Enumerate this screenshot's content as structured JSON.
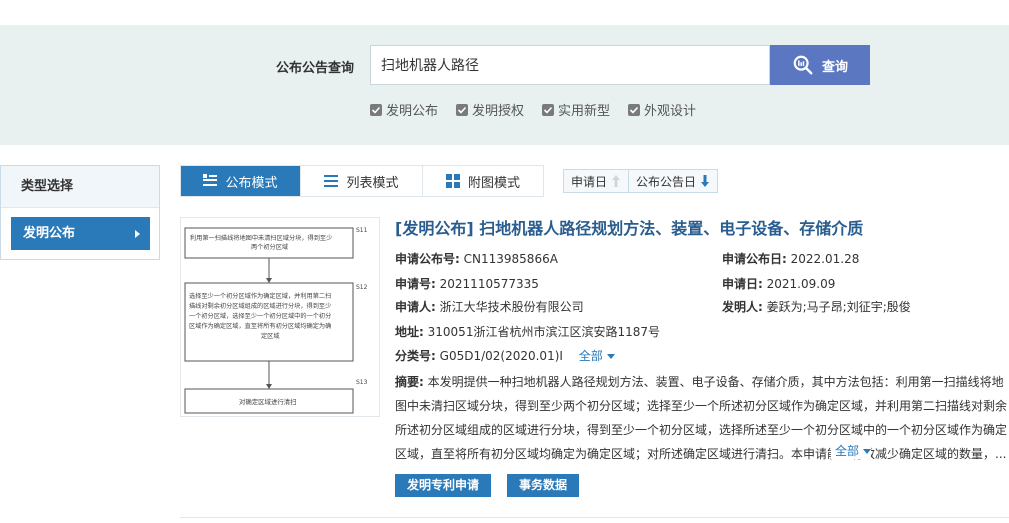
{
  "search": {
    "label": "公布公告查询",
    "query": "扫地机器人路径",
    "button_label": "查询",
    "checkboxes": [
      {
        "label": "发明公布",
        "checked": true
      },
      {
        "label": "发明授权",
        "checked": true
      },
      {
        "label": "实用新型",
        "checked": true
      },
      {
        "label": "外观设计",
        "checked": true
      }
    ]
  },
  "sidebar": {
    "title": "类型选择",
    "items": [
      {
        "label": "发明公布",
        "selected": true
      }
    ]
  },
  "modes": {
    "tabs": [
      {
        "label": "公布模式",
        "icon": "list-detail-icon",
        "active": true
      },
      {
        "label": "列表模式",
        "icon": "list-icon",
        "active": false
      },
      {
        "label": "附图模式",
        "icon": "grid-icon",
        "active": false
      }
    ],
    "sort": [
      {
        "label": "申请日",
        "direction": "up",
        "active": false
      },
      {
        "label": "公布公告日",
        "direction": "down",
        "active": true
      }
    ]
  },
  "result": {
    "title": "[发明公布] 扫地机器人路径规划方法、装置、电子设备、存储介质",
    "pub_no_label": "申请公布号:",
    "pub_no": "CN113985866A",
    "pub_date_label": "申请公布日:",
    "pub_date": "2022.01.28",
    "app_no_label": "申请号:",
    "app_no": "2021110577335",
    "app_date_label": "申请日:",
    "app_date": "2021.09.09",
    "applicant_label": "申请人:",
    "applicant": "浙江大华技术股份有限公司",
    "inventor_label": "发明人:",
    "inventors": "姜跃为;马子昂;刘征宇;殷俊",
    "address_label": "地址:",
    "address": "310051浙江省杭州市滨江区滨安路1187号",
    "class_label": "分类号:",
    "class_no": "G05D1/02(2020.01)I",
    "more_label": "全部",
    "abstract_label": "摘要:",
    "abstract": "本发明提供一种扫地机器人路径规划方法、装置、电子设备、存储介质，其中方法包括：利用第一扫描线将地图中未清扫区域分块，得到至少两个初分区域；选择至少一个所述初分区域作为确定区域，并利用第二扫描线对剩余所述初分区域组成的区域进行分块，得到至少一个初分区域，选择所述至少一个初分区域中的一个初分区域作为确定区域，直至将所有初分区域均确定为确定区域；对所述确定区域进行清扫。本申请能够有效减少确定区域的数量，...",
    "abstract_more": "全部",
    "buttons": [
      "发明专利申请",
      "事务数据"
    ]
  },
  "flowchart": {
    "steps": [
      {
        "text": "利用第一扫描线将地图中未清扫区域分块，得到至少两个初分区域",
        "code": "S11"
      },
      {
        "text": "选择至少一个初分区域作为确定区域，并利用第二扫描线对剩余初分区域组成的区域进行分块，得到至少一个初分区域，选择至少一个初分区域中的一个初分区域作为确定区域，直至将所有初分区域均确定为确定区域",
        "code": "S12"
      },
      {
        "text": "对确定区域进行清扫",
        "code": "S13"
      }
    ]
  }
}
